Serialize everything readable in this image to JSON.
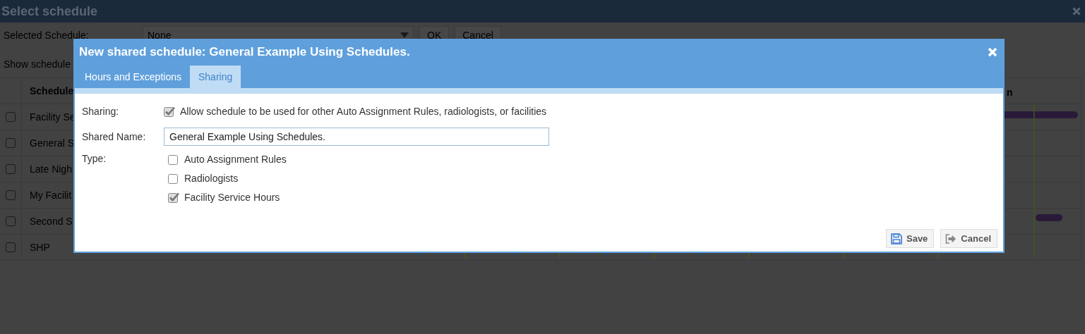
{
  "window": {
    "title": "Select schedule"
  },
  "toolbar": {
    "selected_label": "Selected Schedule:",
    "dropdown_value": "None",
    "ok": "OK",
    "cancel": "Cancel",
    "show_label": "Show schedule"
  },
  "table": {
    "columns": [
      "Schedule",
      "n"
    ],
    "rows": [
      {
        "name": "Facility Se",
        "checked": false
      },
      {
        "name": "General S",
        "checked": false
      },
      {
        "name": "Late Nigh",
        "checked": false
      },
      {
        "name": "My Facilit",
        "checked": false
      },
      {
        "name": "Second S",
        "checked": false
      },
      {
        "name": "SHP",
        "checked": false
      }
    ]
  },
  "dialog": {
    "title": "New shared schedule: General Example Using Schedules.",
    "tabs": [
      {
        "label": "Hours and Exceptions",
        "selected": false
      },
      {
        "label": "Sharing",
        "selected": true
      }
    ],
    "sharing_label": "Sharing:",
    "allow": {
      "label": "Allow schedule to be used for other Auto Assignment Rules, radiologists, or facilities",
      "checked": true
    },
    "shared_name_label": "Shared Name:",
    "shared_name": "General Example Using Schedules.",
    "type_label": "Type:",
    "types": [
      {
        "label": "Auto Assignment Rules",
        "checked": false
      },
      {
        "label": "Radiologists",
        "checked": false
      },
      {
        "label": "Facility Service Hours",
        "checked": true
      }
    ],
    "buttons": [
      {
        "kind": "save",
        "label": "Save"
      },
      {
        "kind": "cancel",
        "label": "Cancel"
      }
    ]
  }
}
